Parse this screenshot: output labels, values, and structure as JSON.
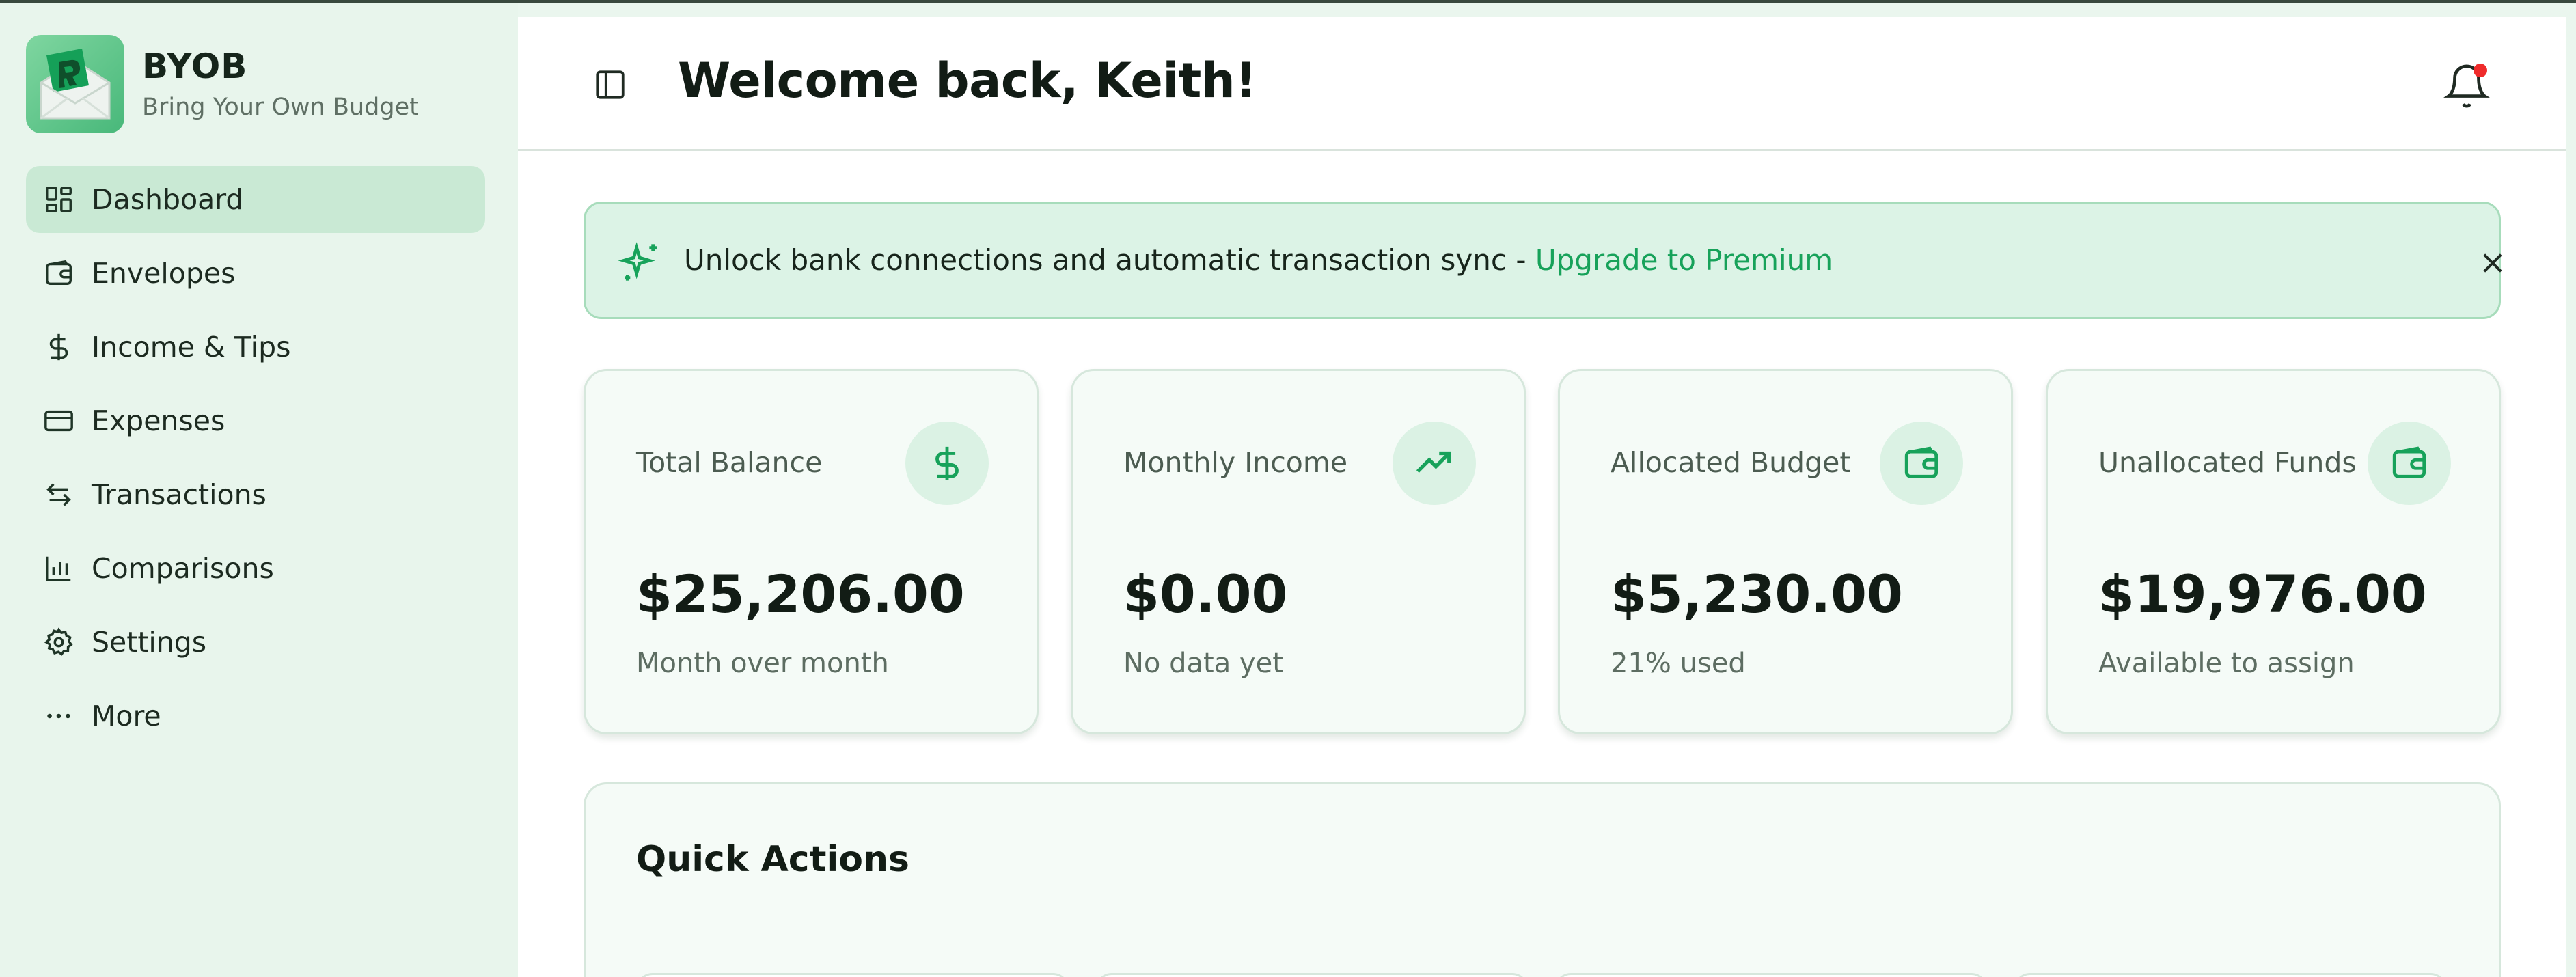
{
  "brand": {
    "name": "BYOB",
    "tagline": "Bring Your Own Budget"
  },
  "nav": [
    {
      "label": "Dashboard",
      "icon": "dashboard-grid-icon",
      "active": true
    },
    {
      "label": "Envelopes",
      "icon": "wallet-icon"
    },
    {
      "label": "Income & Tips",
      "icon": "dollar-icon"
    },
    {
      "label": "Expenses",
      "icon": "credit-card-icon"
    },
    {
      "label": "Transactions",
      "icon": "arrows-swap-icon"
    },
    {
      "label": "Comparisons",
      "icon": "bar-chart-icon"
    },
    {
      "label": "Settings",
      "icon": "gear-icon"
    },
    {
      "label": "More",
      "icon": "more-dots-icon"
    }
  ],
  "header": {
    "title": "Welcome back, Keith!",
    "notification_dot_color": "#ef2b2b"
  },
  "banner": {
    "text": "Unlock bank connections and automatic transaction sync - ",
    "link": "Upgrade to Premium",
    "link_color": "#17a25a"
  },
  "stats": [
    {
      "label": "Total Balance",
      "value": "$25,206.00",
      "sub": "Month over month",
      "icon": "dollar-icon"
    },
    {
      "label": "Monthly Income",
      "value": "$0.00",
      "sub": "No data yet",
      "icon": "trending-up-icon"
    },
    {
      "label": "Allocated Budget",
      "value": "$5,230.00",
      "sub": "21% used",
      "icon": "wallet-icon"
    },
    {
      "label": "Unallocated Funds",
      "value": "$19,976.00",
      "sub": "Available to assign",
      "icon": "wallet-icon"
    }
  ],
  "quick_actions": {
    "title": "Quick Actions"
  },
  "colors": {
    "accent": "#17a25a",
    "sidebar_bg": "#e8f5ec",
    "active_nav_bg": "#c9e9d4"
  }
}
